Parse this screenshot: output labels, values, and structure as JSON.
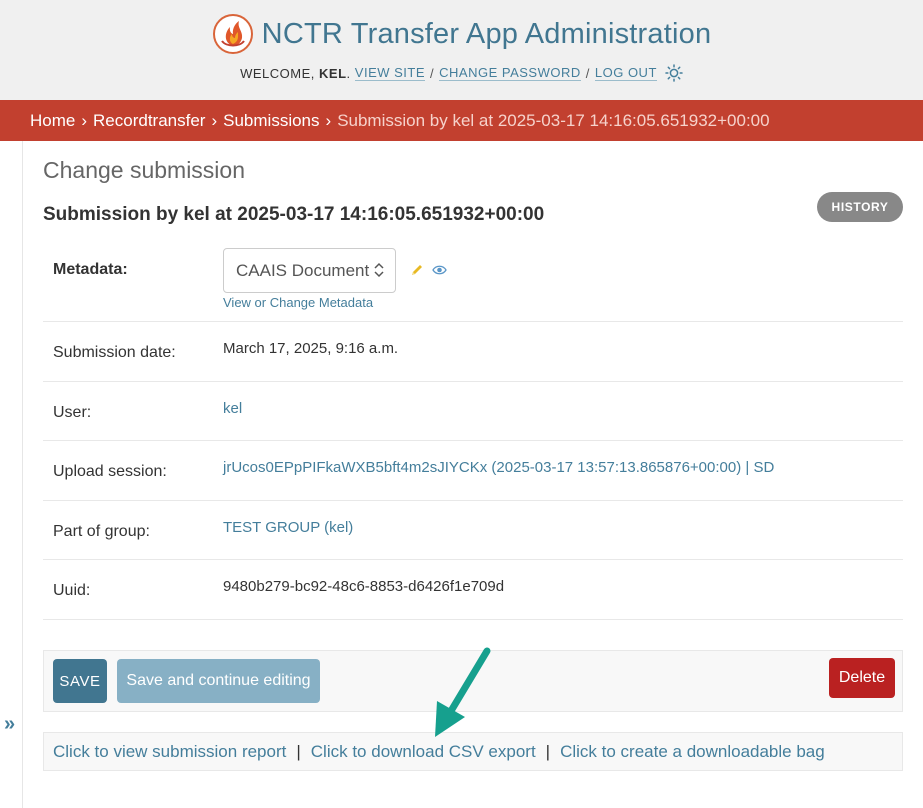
{
  "header": {
    "site_title": "NCTR Transfer App Administration",
    "welcome_prefix": "WELCOME,",
    "username": "KEL",
    "welcome_suffix": ".",
    "view_site": "VIEW SITE",
    "change_password": "CHANGE PASSWORD",
    "log_out": "LOG OUT",
    "separator": "/",
    "logo_icon": "flame-logo-icon",
    "theme_icon": "sun-icon"
  },
  "breadcrumbs": {
    "items": [
      "Home",
      "Recordtransfer",
      "Submissions"
    ],
    "current": "Submission by kel at 2025-03-17 14:16:05.651932+00:00",
    "separator": "›"
  },
  "sidebar": {
    "toggle": "»"
  },
  "page": {
    "content_title": "Change submission",
    "object_title": "Submission by kel at 2025-03-17 14:16:05.651932+00:00",
    "history_button": "HISTORY"
  },
  "form": {
    "metadata": {
      "label": "Metadata:",
      "selected": "CAAIS Document",
      "help_link": "View or Change Metadata",
      "edit_icon": "pencil-icon",
      "view_icon": "eye-icon"
    },
    "submission_date": {
      "label": "Submission date:",
      "value": "March 17, 2025, 9:16 a.m."
    },
    "user": {
      "label": "User:",
      "value": "kel"
    },
    "upload_session": {
      "label": "Upload session:",
      "value": "jrUcos0EPpPIFkaWXB5bft4m2sJIYCKx (2025-03-17 13:57:13.865876+00:00) | SD"
    },
    "part_of_group": {
      "label": "Part of group:",
      "value": "TEST GROUP (kel)"
    },
    "uuid": {
      "label": "Uuid:",
      "value": "9480b279-bc92-48c6-8853-d6426f1e709d"
    }
  },
  "submit_row": {
    "save": "SAVE",
    "save_continue": "Save and continue editing",
    "delete": "Delete"
  },
  "links_row": {
    "view_report": "Click to view submission report",
    "download_csv": "Click to download CSV export",
    "create_bag": "Click to create a downloadable bag",
    "separator": "|"
  },
  "colors": {
    "breadcrumb_bg": "#c2402f",
    "link": "#447e9b",
    "title": "#417690",
    "save_bg": "#417690",
    "delete_bg": "#ba2121",
    "annotation_arrow": "#16a08e"
  }
}
